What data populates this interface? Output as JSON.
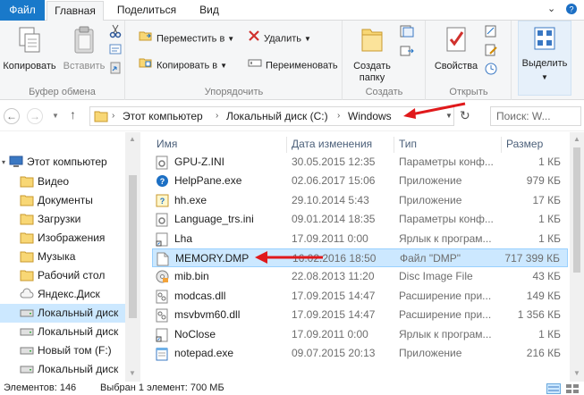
{
  "tabs": {
    "file": "Файл",
    "home": "Главная",
    "share": "Поделиться",
    "view": "Вид"
  },
  "ribbon": {
    "clipboard": {
      "copy": "Копировать",
      "paste": "Вставить",
      "label": "Буфер обмена"
    },
    "organize": {
      "move_to": "Переместить в",
      "copy_to": "Копировать в",
      "delete": "Удалить",
      "rename": "Переименовать",
      "label": "Упорядочить"
    },
    "new": {
      "new_folder_l1": "Создать",
      "new_folder_l2": "папку",
      "label": "Создать"
    },
    "open": {
      "properties": "Свойства",
      "label": "Открыть"
    },
    "select": {
      "select_all": "Выделить"
    }
  },
  "address": {
    "crumbs": [
      "Этот компьютер",
      "Локальный диск (C:)",
      "Windows"
    ],
    "search_placeholder": "Поиск: W..."
  },
  "nav": {
    "items": [
      {
        "label": "Этот компьютер",
        "icon": "computer-icon"
      },
      {
        "label": "Видео",
        "icon": "folder-icon"
      },
      {
        "label": "Документы",
        "icon": "folder-icon"
      },
      {
        "label": "Загрузки",
        "icon": "folder-icon"
      },
      {
        "label": "Изображения",
        "icon": "folder-icon"
      },
      {
        "label": "Музыка",
        "icon": "folder-icon"
      },
      {
        "label": "Рабочий стол",
        "icon": "folder-icon"
      },
      {
        "label": "Яндекс.Диск",
        "icon": "cloud-icon"
      },
      {
        "label": "Локальный диск",
        "icon": "drive-icon"
      },
      {
        "label": "Локальный диск",
        "icon": "drive-icon"
      },
      {
        "label": "Новый том (F:)",
        "icon": "drive-icon"
      },
      {
        "label": "Локальный диск",
        "icon": "drive-icon"
      }
    ]
  },
  "columns": {
    "name": "Имя",
    "date": "Дата изменения",
    "type": "Тип",
    "size": "Размер"
  },
  "files": [
    {
      "name": "GPU-Z.INI",
      "date": "30.05.2015 12:35",
      "type": "Параметры конф...",
      "size": "1 КБ",
      "icon": "ini-icon"
    },
    {
      "name": "HelpPane.exe",
      "date": "02.06.2017 15:06",
      "type": "Приложение",
      "size": "979 КБ",
      "icon": "help-icon"
    },
    {
      "name": "hh.exe",
      "date": "29.10.2014 5:43",
      "type": "Приложение",
      "size": "17 КБ",
      "icon": "help-exe-icon"
    },
    {
      "name": "Language_trs.ini",
      "date": "09.01.2014 18:35",
      "type": "Параметры конф...",
      "size": "1 КБ",
      "icon": "ini-icon"
    },
    {
      "name": "Lha",
      "date": "17.09.2011 0:00",
      "type": "Ярлык к програм...",
      "size": "1 КБ",
      "icon": "shortcut-icon"
    },
    {
      "name": "MEMORY.DMP",
      "date": "16.02.2016 18:50",
      "type": "Файл \"DMP\"",
      "size": "717 399 КБ",
      "icon": "file-icon"
    },
    {
      "name": "mib.bin",
      "date": "22.08.2013 11:20",
      "type": "Disc Image File",
      "size": "43 КБ",
      "icon": "disc-image-icon"
    },
    {
      "name": "modcas.dll",
      "date": "17.09.2015 14:47",
      "type": "Расширение при...",
      "size": "149 КБ",
      "icon": "dll-icon"
    },
    {
      "name": "msvbvm60.dll",
      "date": "17.09.2015 14:47",
      "type": "Расширение при...",
      "size": "1 356 КБ",
      "icon": "dll-icon"
    },
    {
      "name": "NoClose",
      "date": "17.09.2011 0:00",
      "type": "Ярлык к програм...",
      "size": "1 КБ",
      "icon": "shortcut-icon"
    },
    {
      "name": "notepad.exe",
      "date": "09.07.2015 20:13",
      "type": "Приложение",
      "size": "216 КБ",
      "icon": "notepad-icon"
    }
  ],
  "status": {
    "count": "Элементов: 146",
    "selected": "Выбран 1 элемент: 700 МБ"
  },
  "colors": {
    "accent": "#1979ca",
    "selection": "#cce8ff",
    "arrow": "#e0191b",
    "folder": "#f8d775"
  }
}
